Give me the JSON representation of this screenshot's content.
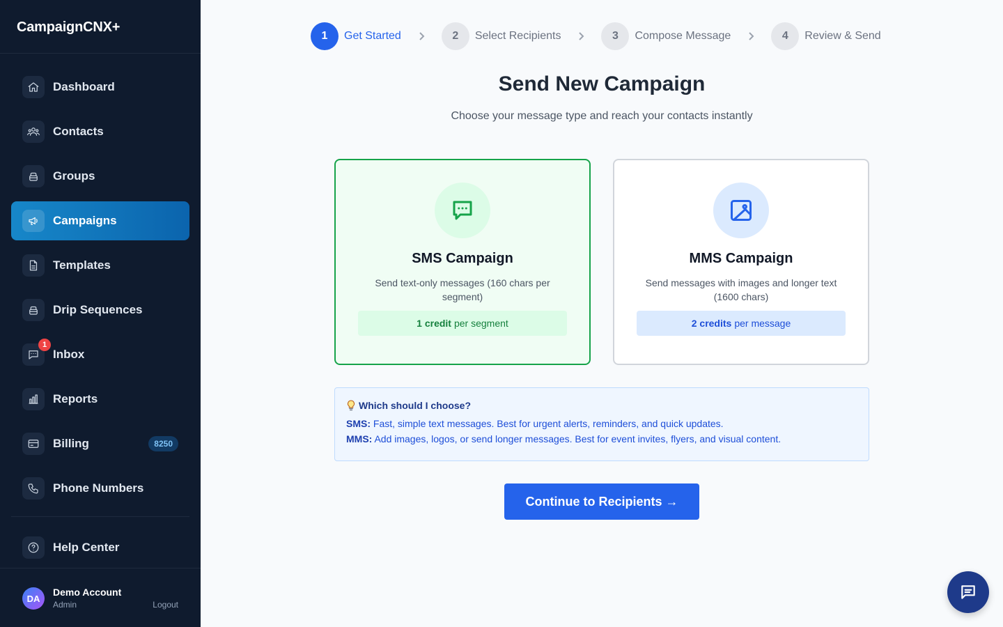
{
  "app": {
    "brand": "CampaignCNX+"
  },
  "sidebar": {
    "items": [
      {
        "label": "Dashboard",
        "icon": "home-icon"
      },
      {
        "label": "Contacts",
        "icon": "users-icon"
      },
      {
        "label": "Groups",
        "icon": "layers-icon"
      },
      {
        "label": "Campaigns",
        "icon": "megaphone-icon",
        "active": true
      },
      {
        "label": "Templates",
        "icon": "document-icon"
      },
      {
        "label": "Drip Sequences",
        "icon": "layers-icon"
      },
      {
        "label": "Inbox",
        "icon": "chat-bubble-icon",
        "badge": "1"
      },
      {
        "label": "Reports",
        "icon": "bar-chart-icon"
      },
      {
        "label": "Billing",
        "icon": "credit-card-icon",
        "badge": "8250"
      },
      {
        "label": "Phone Numbers",
        "icon": "phone-icon"
      }
    ],
    "help": {
      "label": "Help Center",
      "icon": "help-circle-icon"
    },
    "account": {
      "initials": "DA",
      "name": "Demo Account",
      "role": "Admin",
      "logout": "Logout"
    }
  },
  "stepper": {
    "steps": [
      {
        "number": "1",
        "label": "Get Started",
        "active": true
      },
      {
        "number": "2",
        "label": "Select Recipients"
      },
      {
        "number": "3",
        "label": "Compose Message"
      },
      {
        "number": "4",
        "label": "Review & Send"
      }
    ]
  },
  "main": {
    "title": "Send New Campaign",
    "subtitle": "Choose your message type and reach your contacts instantly",
    "cards": [
      {
        "title": "SMS Campaign",
        "description": "Send text-only messages (160 chars per segment)",
        "credit_strong": "1 credit",
        "credit_rest": "per segment",
        "icon": "message-dots-icon",
        "selected": true
      },
      {
        "title": "MMS Campaign",
        "description": "Send messages with images and longer text (1600 chars)",
        "credit_strong": "2 credits",
        "credit_rest": "per message",
        "icon": "image-icon"
      }
    ],
    "info": {
      "heading": "Which should I choose?",
      "sms_label": "SMS:",
      "sms_text": "Fast, simple text messages. Best for urgent alerts, reminders, and quick updates.",
      "mms_label": "MMS:",
      "mms_text": "Add images, logos, or send longer messages. Best for event invites, flyers, and visual content."
    },
    "cta": "Continue to Recipients →"
  },
  "colors": {
    "primary": "#2563eb",
    "sidebar_bg": "#0f1b2e",
    "active_nav": "#1787c9",
    "sms_green": "#16a34a",
    "badge_red": "#ef4444"
  }
}
